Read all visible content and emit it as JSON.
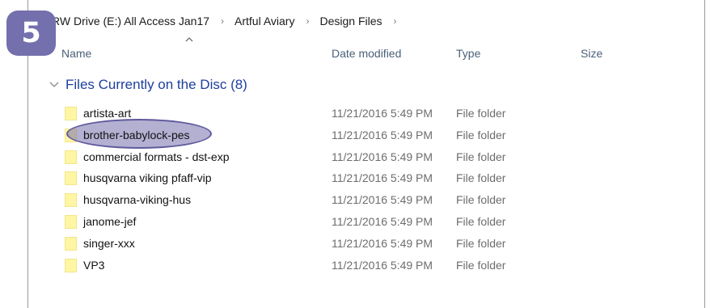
{
  "step_badge": "5",
  "breadcrumb": {
    "items": [
      "RW Drive (E:) All Access Jan17",
      "Artful Aviary",
      "Design Files"
    ],
    "separator": "›"
  },
  "columns": {
    "name": "Name",
    "date_modified": "Date modified",
    "type": "Type",
    "size": "Size",
    "sorted_by": "Name"
  },
  "group": {
    "label": "Files Currently on the Disc (8)",
    "expanded": true
  },
  "files": [
    {
      "name": "artista-art",
      "date": "11/21/2016 5:49 PM",
      "type": "File folder",
      "highlighted": false
    },
    {
      "name": "brother-babylock-pes",
      "date": "11/21/2016 5:49 PM",
      "type": "File folder",
      "highlighted": true
    },
    {
      "name": "commercial formats - dst-exp",
      "date": "11/21/2016 5:49 PM",
      "type": "File folder",
      "highlighted": false
    },
    {
      "name": "husqvarna viking pfaff-vip",
      "date": "11/21/2016 5:49 PM",
      "type": "File folder",
      "highlighted": false
    },
    {
      "name": "husqvarna-viking-hus",
      "date": "11/21/2016 5:49 PM",
      "type": "File folder",
      "highlighted": false
    },
    {
      "name": "janome-jef",
      "date": "11/21/2016 5:49 PM",
      "type": "File folder",
      "highlighted": false
    },
    {
      "name": "singer-xxx",
      "date": "11/21/2016 5:49 PM",
      "type": "File folder",
      "highlighted": false
    },
    {
      "name": "VP3",
      "date": "11/21/2016 5:49 PM",
      "type": "File folder",
      "highlighted": false
    }
  ],
  "colors": {
    "badge": "#7470ad",
    "highlight": "#7470ad",
    "group_header": "#1e3f9e",
    "folder": "#fff6a3"
  },
  "icons": {
    "folder": "folder-icon",
    "sort": "sort-up-icon",
    "group_toggle": "chevron-down-icon",
    "breadcrumb_separator": "chevron-right-icon"
  }
}
